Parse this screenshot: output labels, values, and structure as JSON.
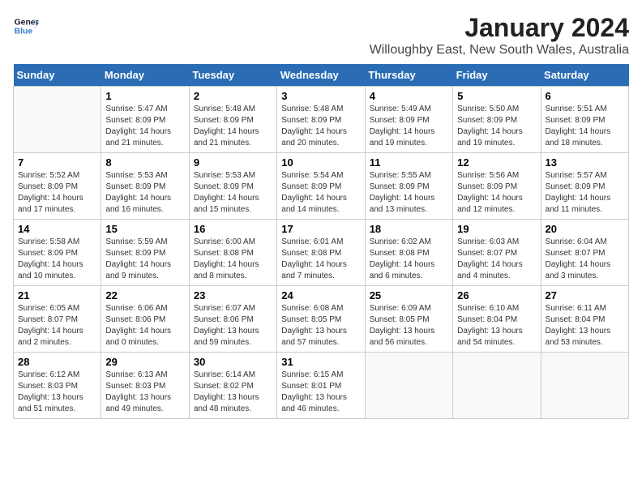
{
  "logo": {
    "line1": "General",
    "line2": "Blue"
  },
  "title": "January 2024",
  "subtitle": "Willoughby East, New South Wales, Australia",
  "weekdays": [
    "Sunday",
    "Monday",
    "Tuesday",
    "Wednesday",
    "Thursday",
    "Friday",
    "Saturday"
  ],
  "weeks": [
    [
      {
        "day": "",
        "info": ""
      },
      {
        "day": "1",
        "info": "Sunrise: 5:47 AM\nSunset: 8:09 PM\nDaylight: 14 hours\nand 21 minutes."
      },
      {
        "day": "2",
        "info": "Sunrise: 5:48 AM\nSunset: 8:09 PM\nDaylight: 14 hours\nand 21 minutes."
      },
      {
        "day": "3",
        "info": "Sunrise: 5:48 AM\nSunset: 8:09 PM\nDaylight: 14 hours\nand 20 minutes."
      },
      {
        "day": "4",
        "info": "Sunrise: 5:49 AM\nSunset: 8:09 PM\nDaylight: 14 hours\nand 19 minutes."
      },
      {
        "day": "5",
        "info": "Sunrise: 5:50 AM\nSunset: 8:09 PM\nDaylight: 14 hours\nand 19 minutes."
      },
      {
        "day": "6",
        "info": "Sunrise: 5:51 AM\nSunset: 8:09 PM\nDaylight: 14 hours\nand 18 minutes."
      }
    ],
    [
      {
        "day": "7",
        "info": "Sunrise: 5:52 AM\nSunset: 8:09 PM\nDaylight: 14 hours\nand 17 minutes."
      },
      {
        "day": "8",
        "info": "Sunrise: 5:53 AM\nSunset: 8:09 PM\nDaylight: 14 hours\nand 16 minutes."
      },
      {
        "day": "9",
        "info": "Sunrise: 5:53 AM\nSunset: 8:09 PM\nDaylight: 14 hours\nand 15 minutes."
      },
      {
        "day": "10",
        "info": "Sunrise: 5:54 AM\nSunset: 8:09 PM\nDaylight: 14 hours\nand 14 minutes."
      },
      {
        "day": "11",
        "info": "Sunrise: 5:55 AM\nSunset: 8:09 PM\nDaylight: 14 hours\nand 13 minutes."
      },
      {
        "day": "12",
        "info": "Sunrise: 5:56 AM\nSunset: 8:09 PM\nDaylight: 14 hours\nand 12 minutes."
      },
      {
        "day": "13",
        "info": "Sunrise: 5:57 AM\nSunset: 8:09 PM\nDaylight: 14 hours\nand 11 minutes."
      }
    ],
    [
      {
        "day": "14",
        "info": "Sunrise: 5:58 AM\nSunset: 8:09 PM\nDaylight: 14 hours\nand 10 minutes."
      },
      {
        "day": "15",
        "info": "Sunrise: 5:59 AM\nSunset: 8:09 PM\nDaylight: 14 hours\nand 9 minutes."
      },
      {
        "day": "16",
        "info": "Sunrise: 6:00 AM\nSunset: 8:08 PM\nDaylight: 14 hours\nand 8 minutes."
      },
      {
        "day": "17",
        "info": "Sunrise: 6:01 AM\nSunset: 8:08 PM\nDaylight: 14 hours\nand 7 minutes."
      },
      {
        "day": "18",
        "info": "Sunrise: 6:02 AM\nSunset: 8:08 PM\nDaylight: 14 hours\nand 6 minutes."
      },
      {
        "day": "19",
        "info": "Sunrise: 6:03 AM\nSunset: 8:07 PM\nDaylight: 14 hours\nand 4 minutes."
      },
      {
        "day": "20",
        "info": "Sunrise: 6:04 AM\nSunset: 8:07 PM\nDaylight: 14 hours\nand 3 minutes."
      }
    ],
    [
      {
        "day": "21",
        "info": "Sunrise: 6:05 AM\nSunset: 8:07 PM\nDaylight: 14 hours\nand 2 minutes."
      },
      {
        "day": "22",
        "info": "Sunrise: 6:06 AM\nSunset: 8:06 PM\nDaylight: 14 hours\nand 0 minutes."
      },
      {
        "day": "23",
        "info": "Sunrise: 6:07 AM\nSunset: 8:06 PM\nDaylight: 13 hours\nand 59 minutes."
      },
      {
        "day": "24",
        "info": "Sunrise: 6:08 AM\nSunset: 8:05 PM\nDaylight: 13 hours\nand 57 minutes."
      },
      {
        "day": "25",
        "info": "Sunrise: 6:09 AM\nSunset: 8:05 PM\nDaylight: 13 hours\nand 56 minutes."
      },
      {
        "day": "26",
        "info": "Sunrise: 6:10 AM\nSunset: 8:04 PM\nDaylight: 13 hours\nand 54 minutes."
      },
      {
        "day": "27",
        "info": "Sunrise: 6:11 AM\nSunset: 8:04 PM\nDaylight: 13 hours\nand 53 minutes."
      }
    ],
    [
      {
        "day": "28",
        "info": "Sunrise: 6:12 AM\nSunset: 8:03 PM\nDaylight: 13 hours\nand 51 minutes."
      },
      {
        "day": "29",
        "info": "Sunrise: 6:13 AM\nSunset: 8:03 PM\nDaylight: 13 hours\nand 49 minutes."
      },
      {
        "day": "30",
        "info": "Sunrise: 6:14 AM\nSunset: 8:02 PM\nDaylight: 13 hours\nand 48 minutes."
      },
      {
        "day": "31",
        "info": "Sunrise: 6:15 AM\nSunset: 8:01 PM\nDaylight: 13 hours\nand 46 minutes."
      },
      {
        "day": "",
        "info": ""
      },
      {
        "day": "",
        "info": ""
      },
      {
        "day": "",
        "info": ""
      }
    ]
  ]
}
